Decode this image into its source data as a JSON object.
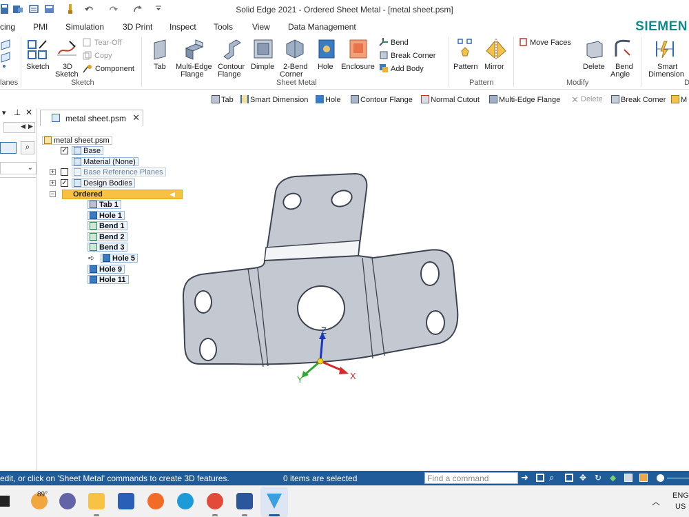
{
  "window": {
    "title": "Solid Edge 2021 - Ordered Sheet Metal - [metal sheet.psm]"
  },
  "brand": "SIEMEN",
  "menu": {
    "tabs": [
      "cing",
      "PMI",
      "Simulation",
      "3D Print",
      "Inspect",
      "Tools",
      "View",
      "Data Management"
    ]
  },
  "ribbon": {
    "planes_group": "lanes",
    "sketch": {
      "sketch_label": "Sketch",
      "sketch3d_line1": "3D",
      "sketch3d_line2": "Sketch",
      "tear_off": "Tear-Off",
      "copy": "Copy",
      "component": "Component",
      "group_label": "Sketch"
    },
    "sheet_metal": {
      "tab": "Tab",
      "multi_edge_line1": "Multi-Edge",
      "multi_edge_line2": "Flange",
      "contour_line1": "Contour",
      "contour_line2": "Flange",
      "dimple": "Dimple",
      "two_bend_line1": "2-Bend",
      "two_bend_line2": "Corner",
      "hole": "Hole",
      "enclosure": "Enclosure",
      "bend": "Bend",
      "break_corner": "Break Corner",
      "add_body": "Add Body",
      "group_label": "Sheet Metal"
    },
    "pattern": {
      "pattern": "Pattern",
      "mirror": "Mirror",
      "group_label": "Pattern"
    },
    "modify": {
      "move_faces": "Move Faces",
      "delete": "Delete",
      "bend_angle_line1": "Bend",
      "bend_angle_line2": "Angle",
      "group_label": "Modify"
    },
    "dimension": {
      "smart_line1": "Smart",
      "smart_line2": "Dimension",
      "group_label": "D"
    }
  },
  "command_bar": {
    "items": [
      "Tab",
      "Smart Dimension",
      "Hole",
      "Contour Flange",
      "Normal Cutout",
      "Multi-Edge Flange",
      "Delete",
      "Break Corner",
      "M"
    ]
  },
  "document_tab": {
    "label": "metal sheet.psm"
  },
  "tree": {
    "root": "metal sheet.psm",
    "base": "Base",
    "material": "Material (None)",
    "ref_planes": "Base Reference Planes",
    "design_bodies": "Design Bodies",
    "ordered": "Ordered",
    "features": [
      "Tab 1",
      "Hole 1",
      "Bend 1",
      "Bend 2",
      "Bend 3",
      "Hole 5",
      "Hole 9",
      "Hole 11"
    ]
  },
  "axes": {
    "x": "X",
    "y": "Y",
    "z": "Z"
  },
  "status": {
    "message": "edit, or click on 'Sheet Metal' commands to create 3D features.",
    "selection": "0 items are selected",
    "find_placeholder": "Find a command"
  },
  "taskbar": {
    "weather": "89°",
    "lang_line1": "ENG",
    "lang_line2": "US"
  },
  "colors": {
    "status_bar": "#1f5c99",
    "brand": "#0d8a8a",
    "ordered_highlight": "#f7c242",
    "part_fill": "#c9cdd4"
  }
}
